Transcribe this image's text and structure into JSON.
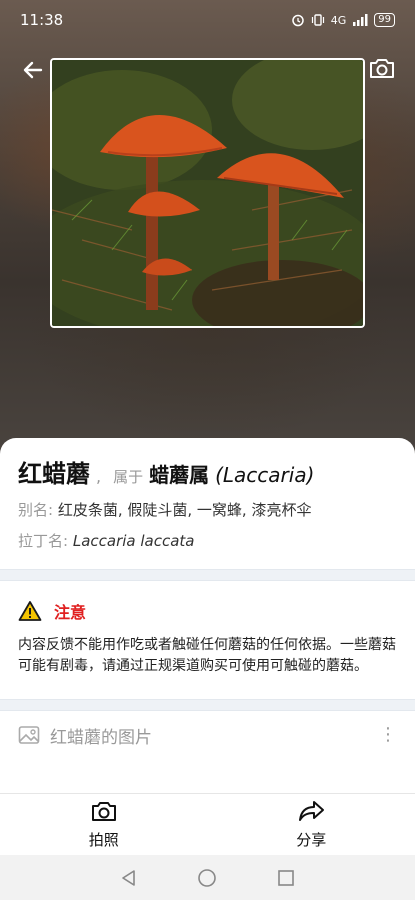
{
  "status_bar": {
    "time": "11:38",
    "network": "4G",
    "battery": "99"
  },
  "icons": {
    "back": "arrow-left-icon",
    "camera_top": "camera-icon",
    "warning": "warning-triangle-icon",
    "gallery": "image-icon",
    "more": "more-vertical-icon",
    "shoot": "camera-icon",
    "share": "share-arrow-icon"
  },
  "species": {
    "name": "红蜡蘑",
    "separator": ",",
    "belongs_label": "属于",
    "genus_cn": "蜡蘑属",
    "genus_latin": "(Laccaria)",
    "alias_label": "别名:",
    "alias_value": "红皮条菌, 假陡斗菌, 一窝蜂, 漆亮杯伞",
    "latin_label": "拉丁名:",
    "latin_value": "Laccaria laccata"
  },
  "notice": {
    "title": "注意",
    "text": "内容反馈不能用作吃或者触碰任何蘑菇的任何依据。一些蘑菇可能有剧毒，请通过正规渠道购买可使用可触碰的蘑菇。"
  },
  "gallery": {
    "label": "红蜡蘑的图片",
    "more": "⋮"
  },
  "actions": {
    "shoot_label": "拍照",
    "share_label": "分享"
  },
  "colors": {
    "warning_red": "#e02020",
    "mushroom_orange": "#d9541e"
  }
}
